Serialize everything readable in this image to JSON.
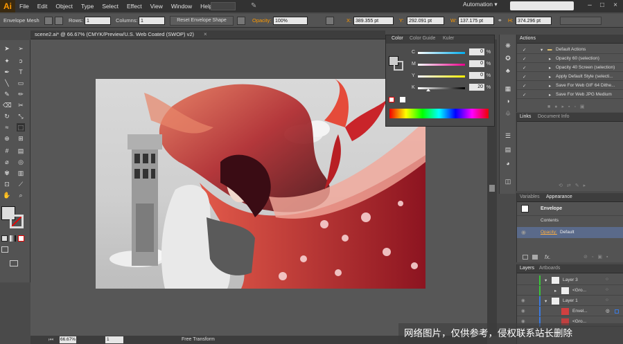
{
  "app": {
    "logo": "Ai",
    "workspace": "Automation",
    "workspace_arrow": "▾",
    "win_min": "–",
    "win_max": "□",
    "win_close": "×"
  },
  "menu": [
    "File",
    "Edit",
    "Object",
    "Type",
    "Select",
    "Effect",
    "View",
    "Window",
    "Help"
  ],
  "control": {
    "tool_name": "Envelope Mesh",
    "rows_label": "Rows:",
    "rows_value": "1",
    "columns_label": "Columns:",
    "columns_value": "1",
    "reset_button": "Reset Envelope Shape",
    "opacity_label": "Opacity:",
    "opacity_value": "100%",
    "x_label": "X:",
    "x_value": "389.355 pt",
    "y_label": "Y:",
    "y_value": "292.091 pt",
    "w_label": "W:",
    "w_value": "137.175 pt",
    "h_label": "H:",
    "h_value": "374.296 pt"
  },
  "document": {
    "tab_title": "scene2.ai* @ 66.67% (CMYK/Preview/U.S. Web Coated (SWOP) v2)",
    "close": "×"
  },
  "status": {
    "zoom": "66.67%",
    "page": "1",
    "mode": "Free Transform"
  },
  "color_panel": {
    "tabs": [
      "Color",
      "Color Guide",
      "Kuler"
    ],
    "channels": [
      {
        "label": "C",
        "value": "0",
        "color": "#00aeef"
      },
      {
        "label": "M",
        "value": "0",
        "color": "#ec008c"
      },
      {
        "label": "Y",
        "value": "0",
        "color": "#fff200"
      },
      {
        "label": "K",
        "value": "20",
        "color": "#000000"
      }
    ],
    "percent": "%"
  },
  "actions": {
    "header": "Actions",
    "items": [
      "Default Actions",
      "Opacity 60 (selection)",
      "Opacity 40 Screen (selection)",
      "Apply Default Style (selecti...",
      "Save For Web GIF 64 Dithe...",
      "Save For Web JPG Medium"
    ]
  },
  "links": {
    "tabs": [
      "Links",
      "Document Info"
    ]
  },
  "appearance": {
    "tabs": [
      "Variables",
      "Appearance"
    ],
    "object": "Envelope",
    "contents": "Contents",
    "opacity_label": "Opacity:",
    "opacity_value": "Default",
    "fx": "fx."
  },
  "layers": {
    "tabs": [
      "Layers",
      "Artboards"
    ],
    "items": [
      "Layer 3",
      "<Gro...",
      "Layer 1",
      "Envel...",
      "<Gro..."
    ]
  },
  "watermark": "网络图片，仅供参考，侵权联系站长删除",
  "colors": {
    "accent": "#ff9a00",
    "panel": "#535353",
    "header": "#3d3d3d",
    "selected": "#5a6a8a"
  }
}
